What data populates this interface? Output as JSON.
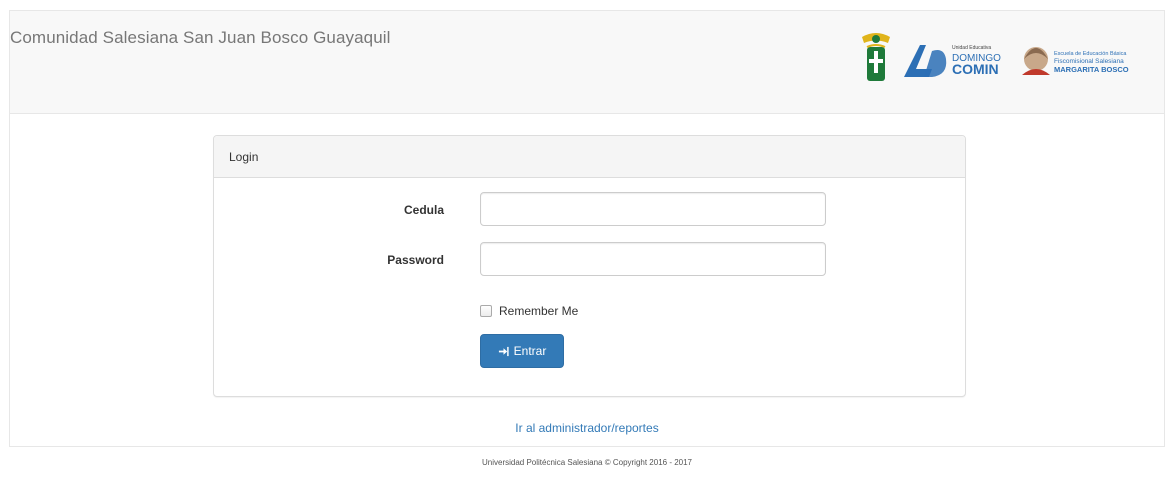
{
  "navbar": {
    "brand": "Comunidad Salesiana San Juan Bosco Guayaquil",
    "logos": {
      "comin": {
        "small_text": "Unidad Educativa",
        "line1": "DOMINGO",
        "line2": "COMIN"
      },
      "bosco": {
        "line1": "Escuela de Educación Básica",
        "line2": "Fiscomisional Salesiana",
        "line3": "MARGARITA BOSCO"
      }
    }
  },
  "login": {
    "heading": "Login",
    "fields": {
      "cedula": {
        "label": "Cedula",
        "value": ""
      },
      "password": {
        "label": "Password",
        "value": ""
      }
    },
    "remember_label": "Remember Me",
    "submit_label": "Entrar"
  },
  "links": {
    "admin": "Ir al administrador/reportes"
  },
  "footer": {
    "text": "Universidad Politécnica Salesiana © Copyright 2016 - 2017"
  },
  "colors": {
    "primary": "#337ab7",
    "navbar_bg": "#f8f8f8",
    "brand_text": "#777777",
    "logo_green": "#1f7a3a",
    "logo_gold": "#e0b41b",
    "logo_blue": "#2c6fb5",
    "logo_red": "#c0392b"
  },
  "icons": {
    "seal": "shield-seal-icon",
    "submit": "sign-in-icon",
    "checkbox": "checkbox-icon"
  }
}
